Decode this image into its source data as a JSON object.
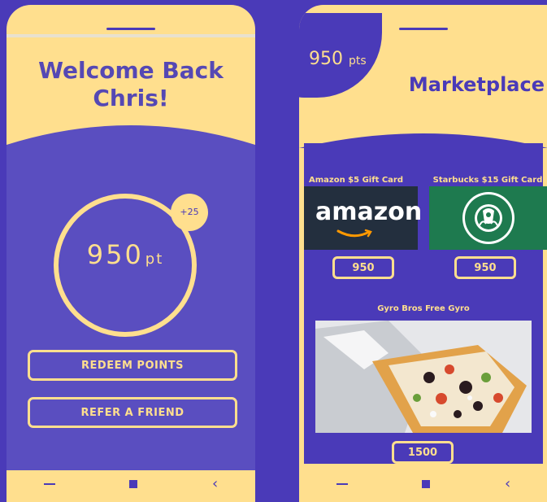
{
  "left_phone": {
    "welcome_line1": "Welcome Back",
    "welcome_line2": "Chris!",
    "points_value": "950",
    "points_unit": "pt",
    "bonus": "+25",
    "redeem_label": "REDEEM POINTS",
    "refer_label": "REFER A FRIEND"
  },
  "right_phone": {
    "points_value": "950",
    "points_unit": "pts",
    "title": "Marketplace",
    "cards": [
      {
        "title": "Amazon $5 Gift Card",
        "logo_text": "amazon",
        "price": "950"
      },
      {
        "title": "Starbucks $15 Gift Card",
        "logo_text": "STARBUCKS COFFEE",
        "price": "950"
      },
      {
        "title": "Gyro Bros Free Gyro",
        "price": "1500"
      }
    ]
  },
  "nav": {
    "recent_icon": "recent-apps-icon",
    "home_icon": "home-square-icon",
    "back_icon": "back-chevron-icon"
  },
  "colors": {
    "background": "#4a3ab8",
    "accent": "#ffdf8e",
    "panel": "#5a4ec0",
    "amazon_bg": "#232f3e",
    "starbucks_bg": "#1e7a4f"
  }
}
